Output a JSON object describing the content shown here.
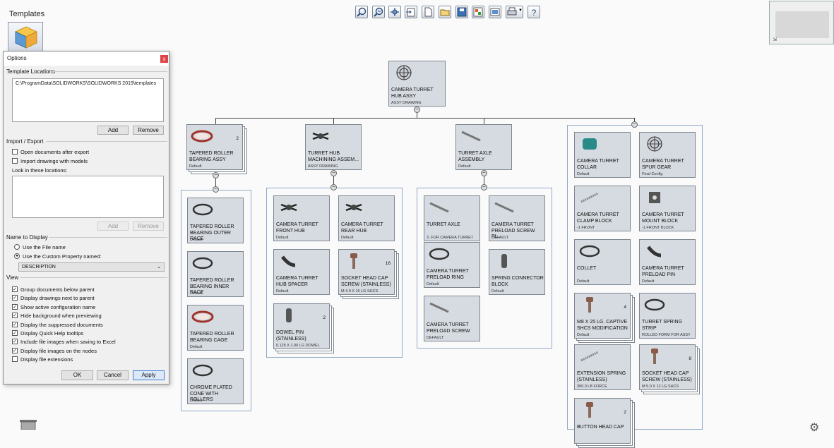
{
  "templates_label": "Templates",
  "toolbar": [
    "zoom-in-icon",
    "zoom-fit-icon",
    "settings-icon",
    "import-icon",
    "new-document-icon",
    "open-icon",
    "save-icon",
    "palette-icon",
    "export-icon",
    "print-icon",
    "help-icon"
  ],
  "dialog": {
    "title": "Options",
    "close": "x",
    "template_locations_label": "Template Locations",
    "template_path": "C:\\ProgramData\\SOLIDWORKS\\SOLIDWORKS 2019\\templates",
    "add_label": "Add",
    "remove_label": "Remove",
    "import_export_label": "Import / Export",
    "import_options": [
      {
        "label": "Open documents after export",
        "checked": false
      },
      {
        "label": "Import drawings with models",
        "checked": false
      }
    ],
    "look_in_label": "Look in these locations:",
    "name_display_label": "Name to Display",
    "radio_options": [
      {
        "label": "Use the File name",
        "checked": false
      },
      {
        "label": "Use the Custom Property named:",
        "checked": true
      }
    ],
    "property_value": "DESCRIPTION",
    "view_label": "View",
    "view_options": [
      {
        "label": "Group documents below parent",
        "checked": true
      },
      {
        "label": "Display drawings next to parent",
        "checked": true
      },
      {
        "label": "Show active configuration name",
        "checked": true
      },
      {
        "label": "Hide background when previewing",
        "checked": true
      },
      {
        "label": "Display the suppressed documents",
        "checked": true
      },
      {
        "label": "Display Quick Help tooltips",
        "checked": true
      },
      {
        "label": "Include file images when saving to Excel",
        "checked": true
      },
      {
        "label": "Display file images on the nodes",
        "checked": true
      },
      {
        "label": "Display file extensions",
        "checked": false
      }
    ],
    "ok_label": "OK",
    "cancel_label": "Cancel",
    "apply_label": "Apply"
  },
  "tree": {
    "root": {
      "name": "CAMERA TURRET HUB ASSY",
      "config": "ASSY DRAWING"
    },
    "level1": [
      {
        "name": "TAPERED ROLLER BEARING ASSY",
        "config": "Default",
        "qty": "2"
      },
      {
        "name": "TURRET HUB MACHINING ASSEM...",
        "config": "ASSY DRAWING",
        "qty": ""
      },
      {
        "name": "TURRET AXLE ASSEMBLY",
        "config": "Default",
        "qty": ""
      }
    ],
    "group1": [
      {
        "name": "TAPERED ROLLER BEARING OUTER RACE",
        "config": "Default",
        "qty": ""
      },
      {
        "name": "TAPERED ROLLER BEARING INNER RACE",
        "config": "Default",
        "qty": ""
      },
      {
        "name": "TAPERED ROLLER BEARING CAGE",
        "config": "Default",
        "qty": ""
      },
      {
        "name": "CHROME PLATED CONE WITH ROLLERS",
        "config": "Default",
        "qty": ""
      }
    ],
    "group2": [
      {
        "name": "CAMERA TURRET FRONT HUB",
        "config": "Default",
        "qty": ""
      },
      {
        "name": "CAMERA TURRET REAR HUB",
        "config": "Default",
        "qty": ""
      },
      {
        "name": "CAMERA TURRET HUB SPACER",
        "config": "Default",
        "qty": ""
      },
      {
        "name": "SOCKET HEAD CAP SCREW (STAINLESS)",
        "config": "M 4.0 X 16 LG SHCS",
        "qty": "16"
      },
      {
        "name": "DOWEL PIN (STAINLESS)",
        "config": "0.125 X 1.00 LG DOWEL",
        "qty": "2"
      }
    ],
    "group3": [
      {
        "name": "TURRET AXLE",
        "config": "3. FOR CAMERA TURRET",
        "qty": ""
      },
      {
        "name": "CAMERA TURRET PRELOAD SCREW PL...",
        "config": "DEFAULT",
        "qty": ""
      },
      {
        "name": "CAMERA TURRET PRELOAD RING",
        "config": "Default",
        "qty": ""
      },
      {
        "name": "SPRING CONNECTOR BLOCK",
        "config": "Default",
        "qty": ""
      },
      {
        "name": "CAMERA TURRET PRELOAD SCREW",
        "config": "DEFAULT",
        "qty": ""
      }
    ],
    "group4": [
      {
        "name": "CAMERA TURRET COLLAR",
        "config": "Default",
        "qty": ""
      },
      {
        "name": "CAMERA TURRET SPUR GEAR",
        "config": "Final Config",
        "qty": ""
      },
      {
        "name": "CAMERA TURRET CLAMP BLOCK",
        "config": "-1 FRONT",
        "qty": ""
      },
      {
        "name": "CAMERA TURRET MOUNT BLOCK",
        "config": "-1 FRONT BLOCK",
        "qty": ""
      },
      {
        "name": "COLLET",
        "config": "Default",
        "qty": ""
      },
      {
        "name": "CAMERA TURRET PRELOAD PIN",
        "config": "Default",
        "qty": ""
      },
      {
        "name": "M8 X 25 LG. CAPTIVE SHCS MODIFICATION",
        "config": "Default",
        "qty": "4"
      },
      {
        "name": "TURRET SPRING STRIP",
        "config": "ROLLED FORM FOR ASSY",
        "qty": ""
      },
      {
        "name": "EXTENSION SPRING (STAINLESS)",
        "config": "300.0 LB FORCE",
        "qty": ""
      },
      {
        "name": "SOCKET HEAD CAP SCREW (STAINLESS)",
        "config": "M 5.0 X 12 LG SHCS",
        "qty": "8"
      },
      {
        "name": "BUTTON HEAD CAP",
        "config": "",
        "qty": "2"
      }
    ]
  },
  "colors": {
    "node_bg": "#d6dbe1",
    "group_border": "#92a8c8",
    "accent": "#3c7fd6",
    "close": "#e04343"
  }
}
